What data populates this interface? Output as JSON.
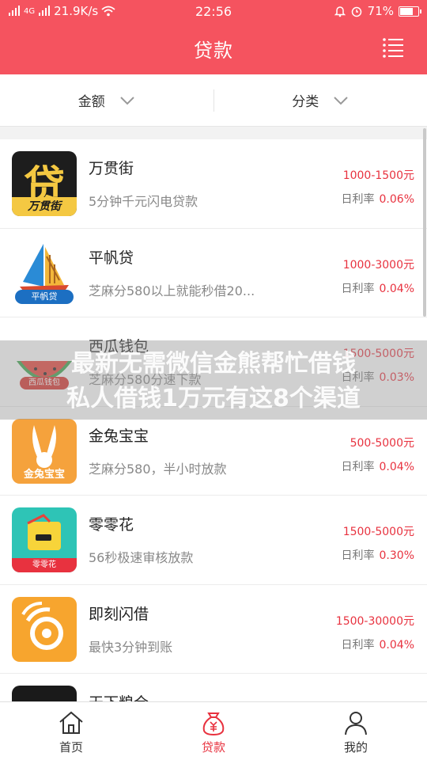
{
  "status": {
    "network": "4G",
    "speed": "21.9K/s",
    "time": "22:56",
    "battery": "71%",
    "battery_level": 0.71
  },
  "nav": {
    "title": "贷款"
  },
  "filters": [
    {
      "label": "金额"
    },
    {
      "label": "分类"
    }
  ],
  "loans": [
    {
      "name": "万贯街",
      "desc": "5分钟千元闪电贷款",
      "amount": "1000-1500元",
      "rate_label": "日利率",
      "rate": "0.06%",
      "logo_text": "万贯街",
      "logo_char": "贷"
    },
    {
      "name": "平帆贷",
      "desc": "芝麻分580以上就能秒借20...",
      "amount": "1000-3000元",
      "rate_label": "日利率",
      "rate": "0.04%",
      "logo_text": "平帆贷"
    },
    {
      "name": "西瓜钱包",
      "desc": "芝麻分580分速下款",
      "amount": "1500-5000元",
      "rate_label": "日利率",
      "rate": "0.03%",
      "logo_text": "西瓜钱包"
    },
    {
      "name": "金兔宝宝",
      "desc": "芝麻分580，半小时放款",
      "amount": "500-5000元",
      "rate_label": "日利率",
      "rate": "0.04%",
      "logo_text": "金兔宝宝"
    },
    {
      "name": "零零花",
      "desc": "56秒极速审核放款",
      "amount": "1500-5000元",
      "rate_label": "日利率",
      "rate": "0.30%",
      "logo_text": "零零花"
    },
    {
      "name": "即刻闪借",
      "desc": "最快3分钟到账",
      "amount": "1500-30000元",
      "rate_label": "日利率",
      "rate": "0.04%"
    },
    {
      "name": "天下粮仓",
      "desc": "",
      "amount": "",
      "rate_label": "",
      "rate": ""
    }
  ],
  "watermark": {
    "line1": "最新无需微信金熊帮忙借钱",
    "line2": "私人借钱1万元有这8个渠道"
  },
  "tabs": [
    {
      "label": "首页",
      "icon": "home-icon"
    },
    {
      "label": "贷款",
      "icon": "money-bag-icon"
    },
    {
      "label": "我的",
      "icon": "user-icon"
    }
  ],
  "colors": {
    "accent": "#f5535f",
    "price": "#e8323f"
  }
}
